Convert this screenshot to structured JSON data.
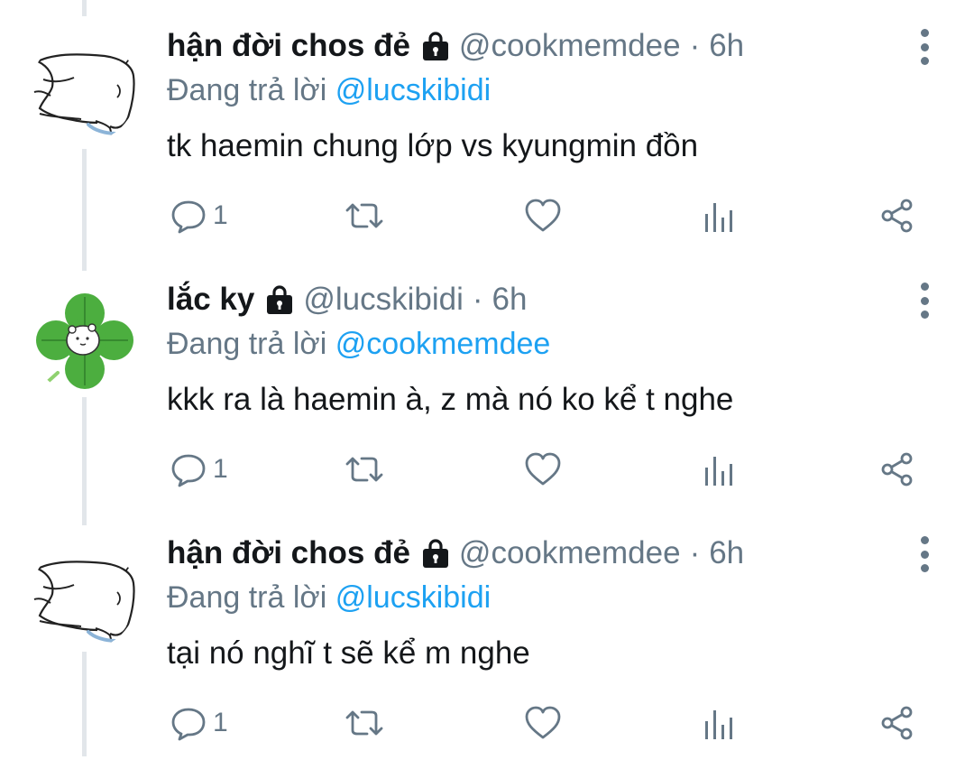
{
  "tweets": [
    {
      "avatar": "doodle-sketch-avatar",
      "name": "hận đời chos đẻ",
      "handle": "@cookmemdee",
      "separator": "·",
      "time": "6h",
      "replying_prefix": "Đang trả lời",
      "replying_to": "@lucskibidi",
      "text": "tk haemin chung lớp vs kyungmin đồn",
      "reply_count": "1"
    },
    {
      "avatar": "clover-leaf-avatar",
      "name": "lắc ky",
      "handle": "@lucskibidi",
      "separator": "·",
      "time": "6h",
      "replying_prefix": "Đang trả lời",
      "replying_to": "@cookmemdee",
      "text": "kkk ra là haemin à, z mà nó ko kể t nghe",
      "reply_count": "1"
    },
    {
      "avatar": "doodle-sketch-avatar",
      "name": "hận đời chos đẻ",
      "handle": "@cookmemdee",
      "separator": "·",
      "time": "6h",
      "replying_prefix": "Đang trả lời",
      "replying_to": "@lucskibidi",
      "text": "tại nó nghĩ t sẽ kể m nghe",
      "reply_count": "1"
    }
  ],
  "icons": {
    "protected": "lock-icon",
    "more": "more-vertical-icon",
    "reply": "reply-bubble-icon",
    "retweet": "retweet-icon",
    "like": "heart-icon",
    "analytics": "analytics-bars-icon",
    "share": "share-icon"
  },
  "colors": {
    "text": "#14171a",
    "muted": "#657786",
    "link": "#1da1f2",
    "thread_line": "#e2e6ea",
    "clover_green": "#4cae3f"
  }
}
